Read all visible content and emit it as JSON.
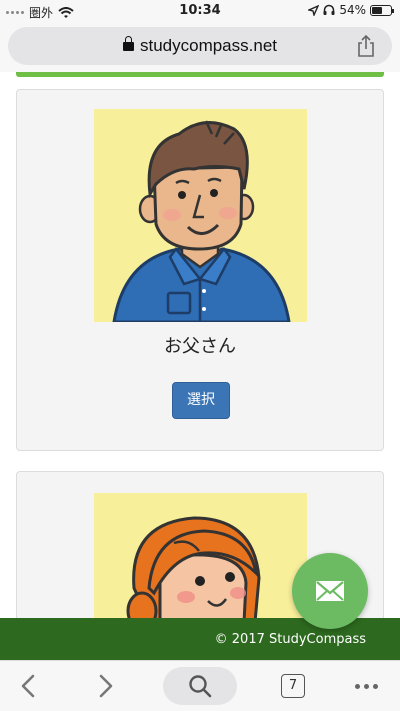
{
  "status_bar": {
    "carrier": "圏外",
    "time": "10:34",
    "battery_text": "54%",
    "battery_level": 0.54
  },
  "browser": {
    "url": "studycompass.net",
    "tab_count": "7"
  },
  "cards": [
    {
      "name": "お父さん",
      "button_label": "選択"
    }
  ],
  "footer": {
    "text": "© 2017 StudyCompass"
  },
  "colors": {
    "accent_green": "#6fbe45",
    "footer_green": "#2d6a1f",
    "button_blue": "#3c75b5",
    "fab_green": "#6cbb63",
    "avatar_bg": "#f8ef9b"
  },
  "icons": [
    "lock-icon",
    "share-icon",
    "wifi-icon",
    "location-icon",
    "headphones-icon",
    "mail-icon",
    "back-icon",
    "forward-icon",
    "search-icon",
    "more-icon"
  ]
}
